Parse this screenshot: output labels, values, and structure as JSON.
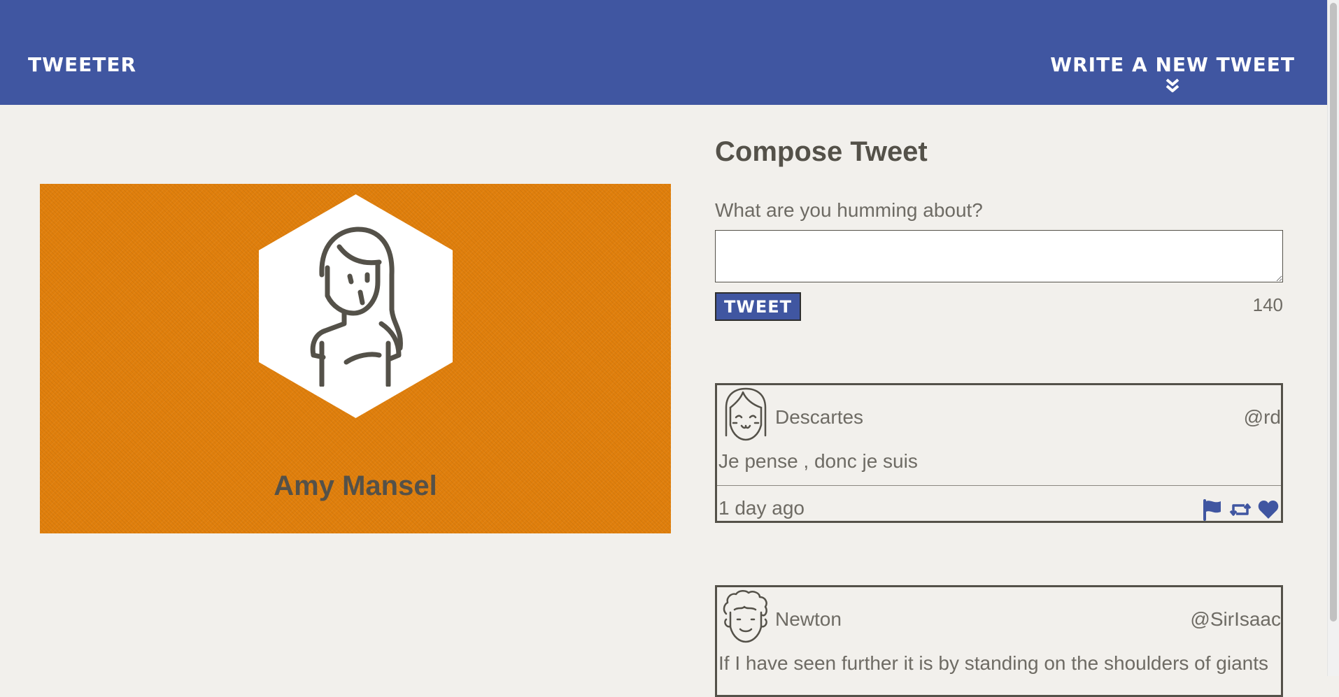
{
  "colors": {
    "nav_bg": "#4056a1",
    "page_bg": "#f2f0ec",
    "profile_bg": "#e07f0c",
    "text": "#545149"
  },
  "nav": {
    "brand": "Tweeter",
    "compose_toggle_label": "Write a new tweet",
    "compose_toggle_icon": "double-chevron-down-icon"
  },
  "profile": {
    "name": "Amy Mansel",
    "avatar_icon": "woman-avatar-icon"
  },
  "compose": {
    "title": "Compose Tweet",
    "prompt": "What are you humming about?",
    "textarea_value": "",
    "submit_label": "Tweet",
    "counter": "140"
  },
  "tweets": [
    {
      "avatar_icon": "bob-hair-avatar-icon",
      "name": "Descartes",
      "handle": "@rd",
      "text": "Je pense , donc je suis",
      "age": "1 day ago",
      "actions": [
        "flag-icon",
        "retweet-icon",
        "heart-icon"
      ]
    },
    {
      "avatar_icon": "curly-hair-avatar-icon",
      "name": "Newton",
      "handle": "@SirIsaac",
      "text": "If I have seen further it is by standing on the shoulders of giants"
    }
  ]
}
